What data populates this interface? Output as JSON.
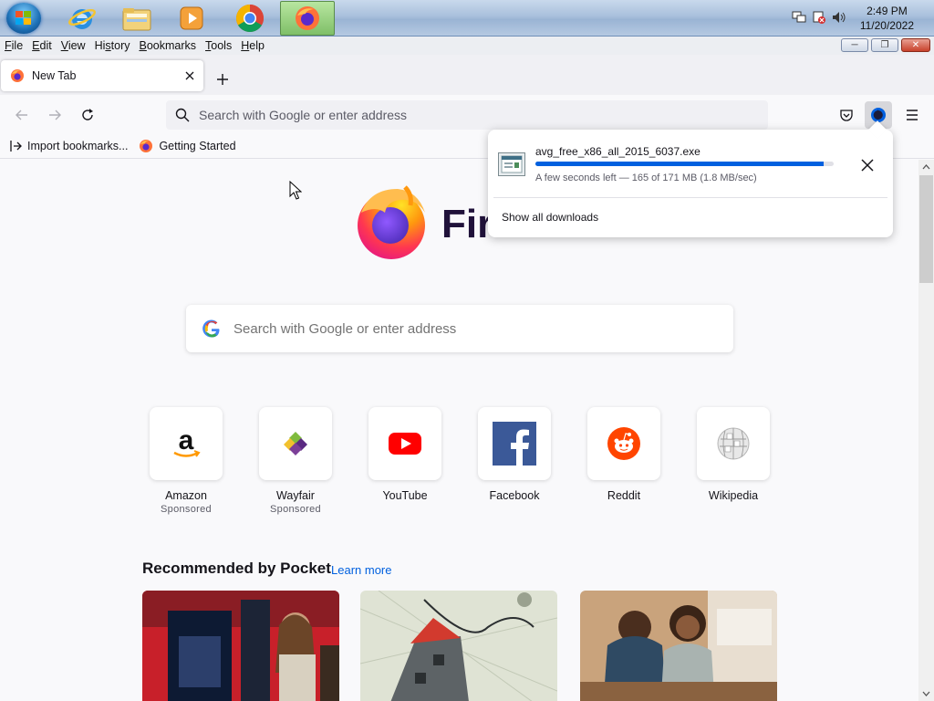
{
  "taskbar": {
    "apps": [
      "Internet Explorer",
      "Windows Explorer",
      "Windows Media Player",
      "Google Chrome",
      "Firefox"
    ],
    "active_app": "Firefox",
    "clock": {
      "time": "2:49 PM",
      "date": "11/20/2022"
    }
  },
  "menubar": {
    "items": [
      {
        "label": "File",
        "accel": "F",
        "rest": "ile"
      },
      {
        "label": "Edit",
        "accel": "E",
        "rest": "dit"
      },
      {
        "label": "View",
        "accel": "V",
        "rest": "iew"
      },
      {
        "label": "History",
        "accel": "",
        "pre": "Hi",
        "under": "s",
        "post": "tory"
      },
      {
        "label": "Bookmarks",
        "accel": "B",
        "rest": "ookmarks"
      },
      {
        "label": "Tools",
        "accel": "T",
        "rest": "ools"
      },
      {
        "label": "Help",
        "accel": "H",
        "rest": "elp"
      }
    ]
  },
  "tab": {
    "title": "New Tab"
  },
  "urlbar": {
    "placeholder": "Search with Google or enter address"
  },
  "bookmarks": {
    "import": "Import bookmarks...",
    "getting_started": "Getting Started"
  },
  "newtab": {
    "wordmark": "Fir",
    "search_placeholder": "Search with Google or enter address",
    "tiles": [
      {
        "label": "Amazon",
        "sub": "Sponsored"
      },
      {
        "label": "Wayfair",
        "sub": "Sponsored"
      },
      {
        "label": "YouTube",
        "sub": ""
      },
      {
        "label": "Facebook",
        "sub": ""
      },
      {
        "label": "Reddit",
        "sub": ""
      },
      {
        "label": "Wikipedia",
        "sub": ""
      }
    ],
    "pocket": {
      "title": "Recommended by Pocket",
      "link": "Learn more"
    }
  },
  "download": {
    "filename": "avg_free_x86_all_2015_6037.exe",
    "status": "A few seconds left — 165 of 171 MB (1.8 MB/sec)",
    "progress": 0.965,
    "show_all": "Show all downloads"
  },
  "colors": {
    "accent": "#0060df",
    "background": "#f9f9fb"
  }
}
